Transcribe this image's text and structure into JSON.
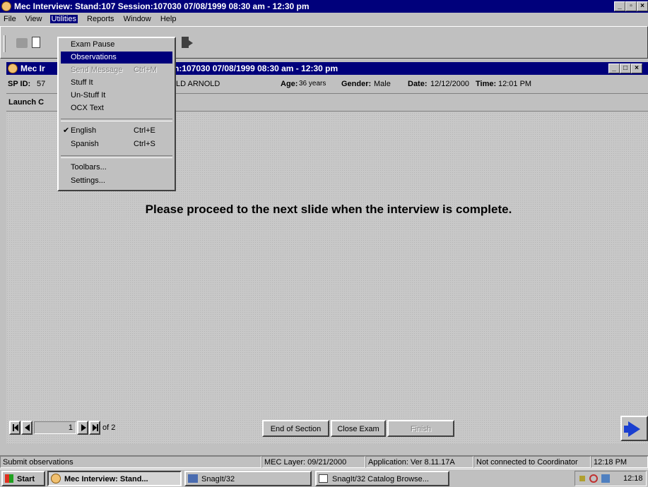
{
  "app": {
    "title": "Mec Interview: Stand:107 Session:107030 07/08/1999 08:30 am - 12:30 pm"
  },
  "menubar": [
    "File",
    "View",
    "Utilities",
    "Reports",
    "Window",
    "Help"
  ],
  "utilities_menu": {
    "items": [
      {
        "label": "Exam Pause",
        "shortcut": ""
      },
      {
        "label": "Observations",
        "shortcut": "",
        "highlighted": true
      },
      {
        "label": "Send Message",
        "shortcut": "Ctrl+M",
        "disabled": true
      },
      {
        "label": "Stuff It",
        "shortcut": ""
      },
      {
        "label": "Un-Stuff It",
        "shortcut": ""
      },
      {
        "label": "OCX Text",
        "shortcut": ""
      },
      {
        "label": "English",
        "shortcut": "Ctrl+E",
        "checked": true
      },
      {
        "label": "Spanish",
        "shortcut": "Ctrl+S"
      },
      {
        "label": "Toolbars...",
        "shortcut": ""
      },
      {
        "label": "Settings...",
        "shortcut": ""
      }
    ]
  },
  "child_window": {
    "title_left": "Mec Ir",
    "title_right": "n:107030 07/08/1999 08:30 am - 12:30 pm"
  },
  "info": {
    "sp_id_label": "SP ID:",
    "sp_id_value": "57",
    "name_partial": "LD ARNOLD",
    "age_label": "Age:",
    "age_value": "36 years",
    "gender_label": "Gender:",
    "gender_value": "Male",
    "date_label": "Date:",
    "date_value": "12/12/2000",
    "time_label": "Time:",
    "time_value": "12:01 PM"
  },
  "launch_label": "Launch C",
  "main_message": "Please proceed to the next slide when the interview is complete.",
  "navigation": {
    "page_value": "1",
    "of_label": "of 2",
    "buttons": [
      "End of Section",
      "Close Exam",
      "Finish"
    ]
  },
  "statusbar": {
    "left": "Submit observations",
    "mec_layer": "MEC Layer: 09/21/2000",
    "application": "Application: Ver 8.11.17A",
    "coordinator": "Not connected to Coordinator",
    "time": "12:18 PM"
  },
  "taskbar": {
    "start": "Start",
    "tasks": [
      "Mec Interview: Stand...",
      "SnagIt/32",
      "SnagIt/32 Catalog Browse..."
    ],
    "clock": "12:18"
  },
  "colors": {
    "title_bar": "#00007b",
    "window_face": "#c0c0c0",
    "menu_highlight": "#00007b",
    "nav_arrow": "#1a3fd0"
  }
}
